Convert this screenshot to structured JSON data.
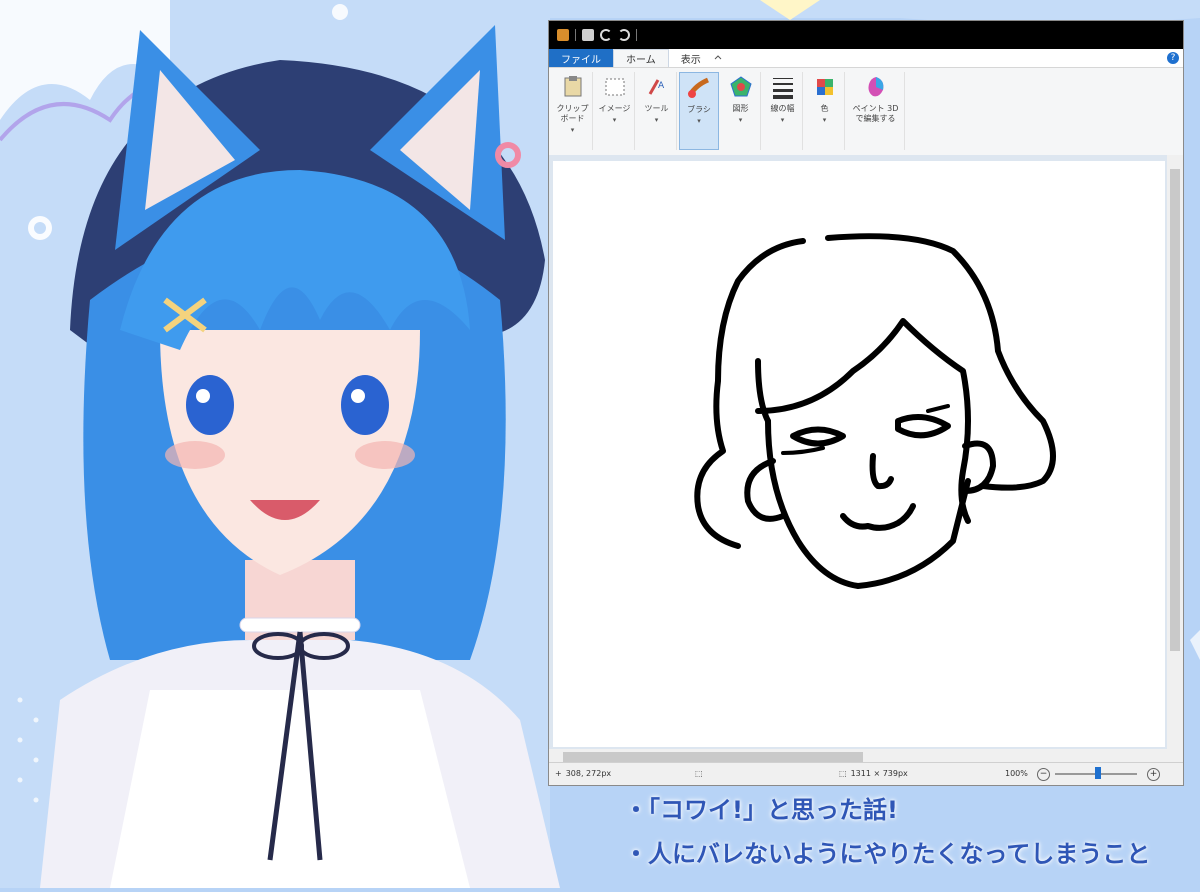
{
  "paint": {
    "tabs": [
      "ファイル",
      "ホーム",
      "表示"
    ],
    "ribbon": [
      {
        "label": "クリップ\nボード",
        "icon": "clipboard-icon"
      },
      {
        "label": "イメージ",
        "icon": "image-select-icon"
      },
      {
        "label": "ツール",
        "icon": "tools-icon"
      },
      {
        "label": "ブラシ",
        "icon": "brush-icon"
      },
      {
        "label": "図形",
        "icon": "shapes-icon"
      },
      {
        "label": "線の幅",
        "icon": "line-width-icon"
      },
      {
        "label": "色",
        "icon": "colors-icon"
      },
      {
        "label": "ペイント 3D\nで編集する",
        "icon": "paint3d-icon"
      }
    ],
    "status": {
      "cursor_pos": "308, 272px",
      "image_size": "1311 × 739px",
      "zoom": "100%"
    }
  },
  "topics": [
    "・「コワイ!」と思った話!",
    "・人にバレないようにやりたくなってしまうこと"
  ],
  "colors": {
    "background": "#b7d3f6",
    "hair": "#3a8fe6",
    "topic_text": "#2f56b6"
  }
}
